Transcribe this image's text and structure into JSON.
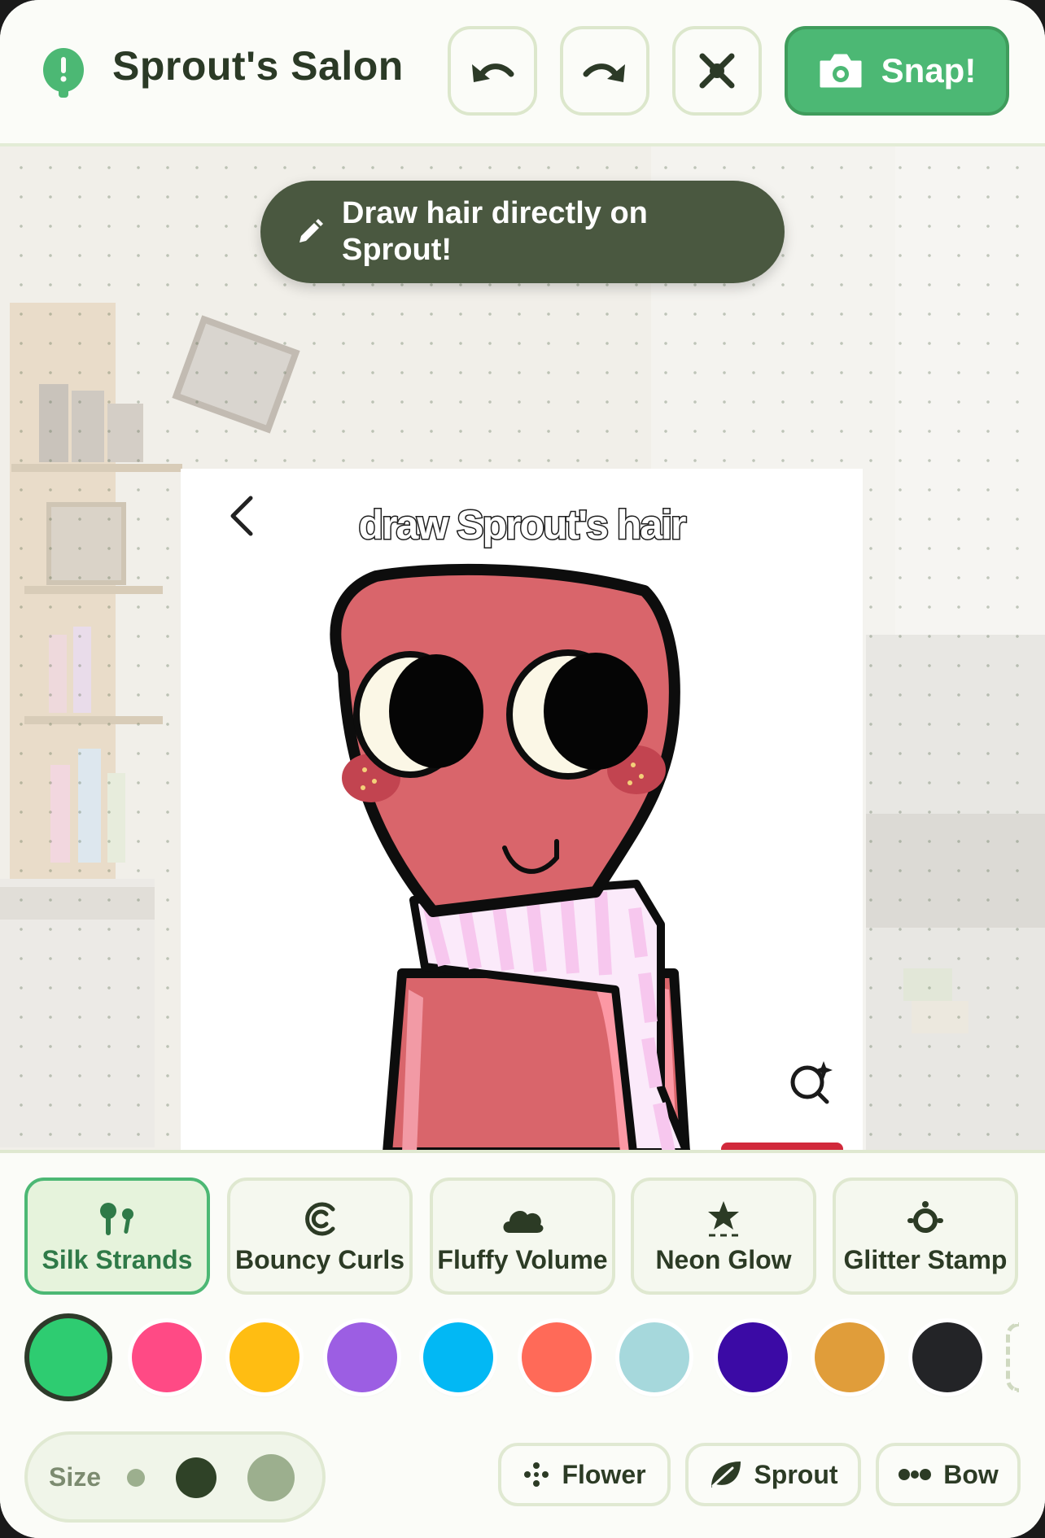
{
  "app": {
    "title": "Sprout's Salon",
    "snap_label": "Snap!",
    "accent_color": "#4cb874"
  },
  "header_buttons": [
    {
      "name": "undo",
      "icon": "undo-icon"
    },
    {
      "name": "redo",
      "icon": "redo-icon"
    },
    {
      "name": "clear",
      "icon": "clear-x-icon"
    }
  ],
  "tip": {
    "text": "Draw hair directly on Sprout!",
    "icon": "pencil-icon"
  },
  "photo": {
    "title": "draw Sprout's hair",
    "icons": [
      "back-arrow-icon",
      "lens-sparkle-icon"
    ]
  },
  "brushes": [
    {
      "label": "Silk Strands",
      "icon": "silk-strands-icon",
      "active": true
    },
    {
      "label": "Bouncy Curls",
      "icon": "curl-icon",
      "active": false
    },
    {
      "label": "Fluffy Volume",
      "icon": "cloud-icon",
      "active": false
    },
    {
      "label": "Neon Glow",
      "icon": "star-icon",
      "active": false
    },
    {
      "label": "Glitter Stamp",
      "icon": "glitter-icon",
      "active": false
    }
  ],
  "colors": {
    "selected": "#2ecc71",
    "palette": [
      "#2ecc71",
      "#ff4a85",
      "#ffbd12",
      "#9c5ee3",
      "#02b8f4",
      "#ff6a58",
      "#a6d8dc",
      "#3b0aa5",
      "#e09d3a",
      "#232427"
    ]
  },
  "size": {
    "label": "Size",
    "options": [
      "small",
      "medium",
      "large"
    ],
    "selected": "medium"
  },
  "stamps": [
    {
      "label": "Flower",
      "icon": "flower-icon"
    },
    {
      "label": "Sprout",
      "icon": "leaf-icon"
    },
    {
      "label": "Bow",
      "icon": "bow-icon"
    }
  ]
}
